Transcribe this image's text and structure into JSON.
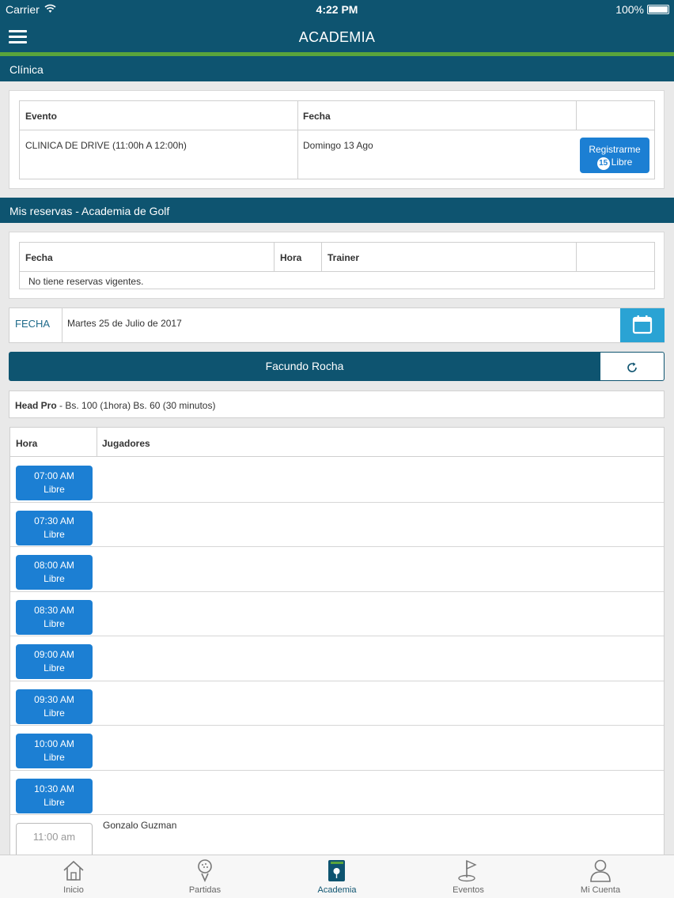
{
  "status_bar": {
    "carrier": "Carrier",
    "time": "4:22 PM",
    "battery": "100%"
  },
  "nav": {
    "title": "ACADEMIA"
  },
  "clinica": {
    "header": "Clínica",
    "columns": [
      "Evento",
      "Fecha"
    ],
    "row": {
      "evento": "CLINICA DE DRIVE (11:00h A 12:00h)",
      "fecha": "Domingo 13 Ago"
    },
    "register_button": {
      "label": "Registrarme",
      "count": "15",
      "status": "Libre"
    }
  },
  "reservas": {
    "header": "Mis reservas - Academia de Golf",
    "columns": [
      "Fecha",
      "Hora",
      "Trainer"
    ],
    "empty_message": "No tiene reservas vigentes."
  },
  "fecha": {
    "label": "FECHA",
    "value": "Martes 25 de Julio de 2017"
  },
  "trainer": {
    "name": "Facundo Rocha"
  },
  "info": {
    "role": "Head Pro",
    "prices": " - Bs. 100 (1hora) Bs. 60 (30 minutos)"
  },
  "schedule": {
    "columns": [
      "Hora",
      "Jugadores"
    ],
    "slots": [
      {
        "time": "07:00 AM",
        "status": "Libre"
      },
      {
        "time": "07:30 AM",
        "status": "Libre"
      },
      {
        "time": "08:00 AM",
        "status": "Libre"
      },
      {
        "time": "08:30 AM",
        "status": "Libre"
      },
      {
        "time": "09:00 AM",
        "status": "Libre"
      },
      {
        "time": "09:30 AM",
        "status": "Libre"
      },
      {
        "time": "10:00 AM",
        "status": "Libre"
      },
      {
        "time": "10:30 AM",
        "status": "Libre"
      }
    ],
    "taken": {
      "time": "11:00 am",
      "player": "Gonzalo Guzman"
    }
  },
  "tabs": [
    {
      "label": "Inicio",
      "icon": "home-icon"
    },
    {
      "label": "Partidas",
      "icon": "golf-ball-icon"
    },
    {
      "label": "Academia",
      "icon": "academy-book-icon"
    },
    {
      "label": "Eventos",
      "icon": "flag-icon"
    },
    {
      "label": "Mi Cuenta",
      "icon": "user-icon"
    }
  ],
  "colors": {
    "primary": "#0e5470",
    "accent_green": "#5aa43c",
    "button_blue": "#1c7fd3",
    "calendar_blue": "#2aa3d4"
  }
}
